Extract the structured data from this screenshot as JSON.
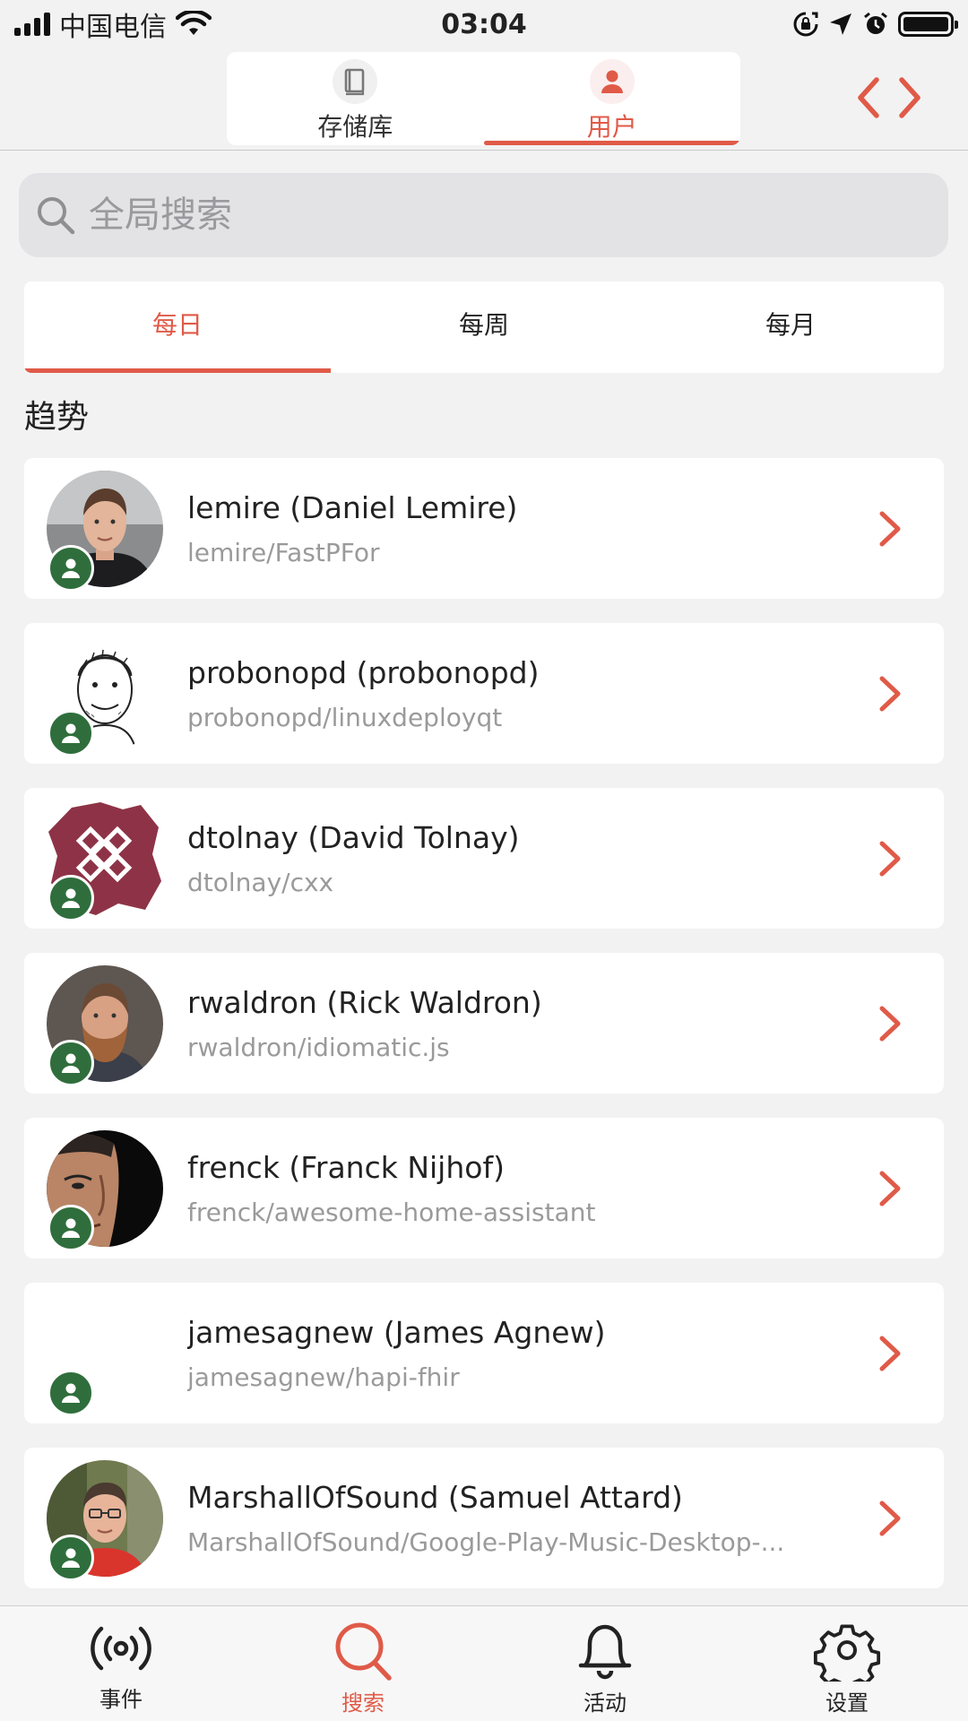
{
  "status_bar": {
    "carrier": "中国电信",
    "time": "03:04"
  },
  "header": {
    "segments": [
      {
        "label": "存储库",
        "icon": "book-icon",
        "active": false
      },
      {
        "label": "用户",
        "icon": "person-icon",
        "active": true
      }
    ],
    "code_icon": "code-icon"
  },
  "search": {
    "placeholder": "全局搜索"
  },
  "period_tabs": [
    {
      "label": "每日",
      "active": true
    },
    {
      "label": "每周",
      "active": false
    },
    {
      "label": "每月",
      "active": false
    }
  ],
  "section_title": "趋势",
  "users": [
    {
      "title": "lemire (Daniel Lemire)",
      "repo": "lemire/FastPFor"
    },
    {
      "title": "probonopd (probonopd)",
      "repo": "probonopd/linuxdeployqt"
    },
    {
      "title": "dtolnay (David Tolnay)",
      "repo": "dtolnay/cxx"
    },
    {
      "title": "rwaldron (Rick Waldron)",
      "repo": "rwaldron/idiomatic.js"
    },
    {
      "title": "frenck (Franck Nijhof)",
      "repo": "frenck/awesome-home-assistant"
    },
    {
      "title": "jamesagnew (James Agnew)",
      "repo": "jamesagnew/hapi-fhir"
    },
    {
      "title": "MarshallOfSound (Samuel Attard)",
      "repo": "MarshallOfSound/Google-Play-Music-Desktop-..."
    }
  ],
  "tabbar": [
    {
      "label": "事件",
      "icon": "broadcast-icon",
      "active": false
    },
    {
      "label": "搜索",
      "icon": "search-icon",
      "active": true
    },
    {
      "label": "活动",
      "icon": "bell-icon",
      "active": false
    },
    {
      "label": "设置",
      "icon": "gear-icon",
      "active": false
    }
  ],
  "colors": {
    "accent": "#e05a48",
    "badge_green": "#2f6e3c",
    "background": "#f2f2f2"
  }
}
